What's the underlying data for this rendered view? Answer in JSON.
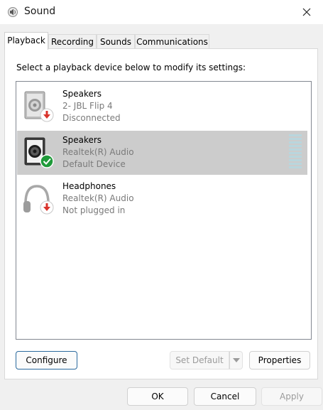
{
  "window": {
    "title": "Sound",
    "icon": "speaker-icon"
  },
  "tabs": [
    {
      "label": "Playback",
      "active": true
    },
    {
      "label": "Recording",
      "active": false
    },
    {
      "label": "Sounds",
      "active": false
    },
    {
      "label": "Communications",
      "active": false
    }
  ],
  "instruction": "Select a playback device below to modify its settings:",
  "devices": [
    {
      "name": "Speakers",
      "line2": "2- JBL Flip 4",
      "line3": "Disconnected",
      "icon": "speaker-icon",
      "badge": "disconnected-arrow-icon",
      "selected": false
    },
    {
      "name": "Speakers",
      "line2": "Realtek(R) Audio",
      "line3": "Default Device",
      "icon": "speaker-icon",
      "badge": "default-check-icon",
      "selected": true
    },
    {
      "name": "Headphones",
      "line2": "Realtek(R) Audio",
      "line3": "Not plugged in",
      "icon": "headphones-icon",
      "badge": "unplugged-arrow-icon",
      "selected": false
    }
  ],
  "buttons": {
    "configure": "Configure",
    "set_default": "Set Default",
    "properties": "Properties",
    "ok": "OK",
    "cancel": "Cancel",
    "apply": "Apply"
  },
  "colors": {
    "selected_row": "#cccccc",
    "badge_red": "#d9332b",
    "badge_green": "#1f9a3a",
    "meter": "#b9d6dd",
    "disabled_text": "#9b9b9b"
  }
}
